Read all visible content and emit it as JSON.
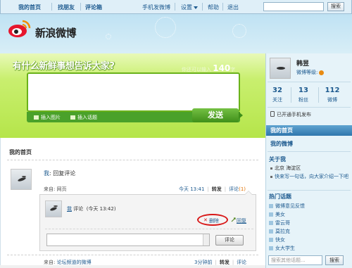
{
  "topnav": {
    "home": "我的首页",
    "find_friends": "找朋友",
    "comments_box": "评论箱",
    "mobile": "手机发微博",
    "settings": "设置",
    "help": "帮助",
    "logout": "退出",
    "search_btn": "搜索"
  },
  "logo": {
    "text": "新浪微博"
  },
  "publisher": {
    "title": "有什么新鲜事想告诉大家?",
    "counter_label": "你还可以输入",
    "counter_num": "140",
    "counter_unit": "字",
    "insert_image": "插入图片",
    "insert_topic": "插入话题",
    "send": "发送"
  },
  "feed": {
    "section_title": "我的首页",
    "post1": {
      "author": "我",
      "content": ": 回复评论",
      "source": "来自: 网页",
      "time": "今天 13:41",
      "forward": "转发",
      "comment": "评论",
      "comment_count": "(1)"
    },
    "comment": {
      "author": "我",
      "label": "评论",
      "time": "(今天 13:42)",
      "delete": "删除",
      "reply": "回复",
      "submit": "评论"
    },
    "post2": {
      "source_prefix": "来自: ",
      "source_link": "论坛频道的微博",
      "time": "3分钟前",
      "forward": "转发",
      "comment": "评论"
    }
  },
  "sidebar": {
    "name": "韩昱",
    "level_label": "微博等级:",
    "stats": [
      {
        "num": "32",
        "label": "关注"
      },
      {
        "num": "13",
        "label": "粉丝"
      },
      {
        "num": "112",
        "label": "微博"
      }
    ],
    "phone": "已开通手机发布",
    "menu_active": "我的首页",
    "menu_second": "我的微博",
    "about_head": "关于我",
    "location": "北京 海淀区",
    "intro": "快来写一句话，向大家介绍一下吧",
    "topics_head": "热门话题",
    "topics": [
      "微博意见反馈",
      "美女",
      "雷云哥",
      "莫拉克",
      "快女",
      "女大学生"
    ],
    "search_placeholder": "搜索其他话题...",
    "search_btn": "搜索"
  }
}
